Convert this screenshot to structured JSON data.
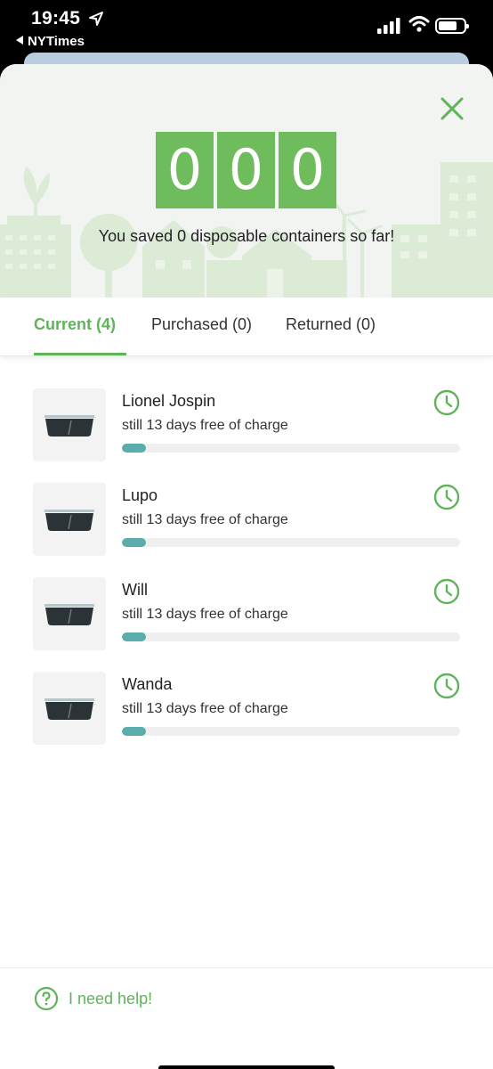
{
  "status_bar": {
    "time": "19:45",
    "back_app": "NYTimes"
  },
  "hero": {
    "counter_digits": [
      "0",
      "0",
      "0"
    ],
    "saved_text": "You saved 0 disposable containers so far!"
  },
  "tabs": [
    {
      "label": "Current (4)",
      "active": true
    },
    {
      "label": "Purchased (0)",
      "active": false
    },
    {
      "label": "Returned (0)",
      "active": false
    }
  ],
  "items": [
    {
      "name": "Lionel Jospin",
      "status": "still 13 days free of charge",
      "progress": 0.07
    },
    {
      "name": "Lupo",
      "status": "still 13 days free of charge",
      "progress": 0.07
    },
    {
      "name": "Will",
      "status": "still 13 days free of charge",
      "progress": 0.07
    },
    {
      "name": "Wanda",
      "status": "still 13 days free of charge",
      "progress": 0.07
    }
  ],
  "footer": {
    "help_label": "I need help!"
  },
  "colors": {
    "accent_green": "#5fb45a",
    "counter_green": "#6ebc5c",
    "progress_teal": "#5aadaa"
  },
  "icons": [
    "location-arrow-icon",
    "signal-icon",
    "wifi-icon",
    "battery-icon",
    "close-icon",
    "container-icon",
    "clock-icon",
    "help-circle-icon"
  ]
}
